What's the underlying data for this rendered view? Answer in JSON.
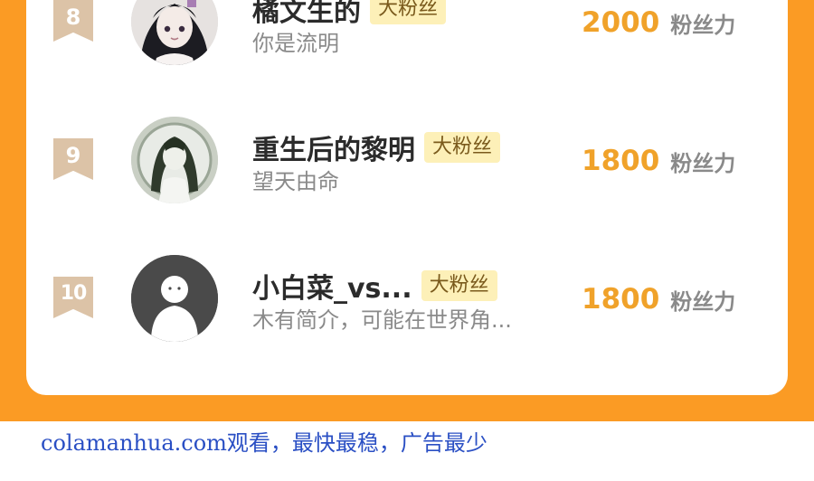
{
  "leaderboard": {
    "entries": [
      {
        "rank": "8",
        "name": "橘文生的",
        "badge": "大粉丝",
        "bio": "你是流明",
        "score": "2000",
        "score_unit": "粉丝力",
        "avatar": "anime-girl-avatar"
      },
      {
        "rank": "9",
        "name": "重生后的黎明",
        "badge": "大粉丝",
        "bio": "望天由命",
        "score": "1800",
        "score_unit": "粉丝力",
        "avatar": "anime-girl-green-hair-avatar"
      },
      {
        "rank": "10",
        "name": "小白菜_vs...",
        "badge": "大粉丝",
        "bio": "木有简介，可能在世界角...",
        "score": "1800",
        "score_unit": "粉丝力",
        "avatar": "default-user-avatar"
      }
    ]
  },
  "footer": {
    "text": "colamanhua.com观看，最快最稳，广告最少"
  },
  "colors": {
    "accent_orange": "#fb9b24",
    "score_gold": "#f0a22a",
    "badge_bg": "#fdf0b8",
    "rank_flag": "#dcc3a7",
    "footer_link": "#2a4fc4"
  }
}
